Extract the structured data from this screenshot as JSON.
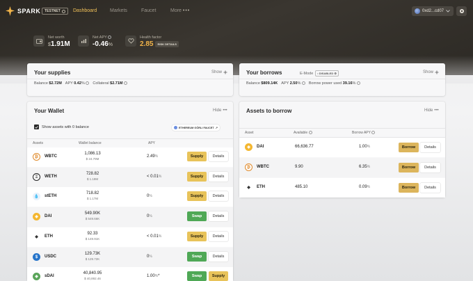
{
  "nav": {
    "brand": "SPARK",
    "testnet": "TESTNET",
    "links": [
      "Dashboard",
      "Markets",
      "Faucet",
      "More"
    ],
    "more_dots": "•••",
    "wallet": "0xd2...cd07"
  },
  "stats": {
    "net_worth": {
      "label": "Net worth",
      "currency": "$",
      "value": "1.91M"
    },
    "net_apy": {
      "label": "Net APY",
      "value": "-0.46",
      "unit": "%"
    },
    "health": {
      "label": "Health factor",
      "value": "2.85",
      "badge": "RISK DETAILS"
    }
  },
  "supplies": {
    "title": "Your supplies",
    "show": "Show",
    "balance_label": "Balance",
    "balance_currency": "$",
    "balance_value": "2.72M",
    "apy_label": "APY",
    "apy_value": "0.42",
    "apy_unit": "%",
    "collateral_label": "Collateral",
    "collateral_currency": "$",
    "collateral_value": "2.71M"
  },
  "borrows": {
    "title": "Your borrows",
    "emode_label": "E-Mode",
    "emode_badge": "DISABLED",
    "show": "Show",
    "balance_label": "Balance",
    "balance_currency": "$",
    "balance_value": "809.14K",
    "apy_label": "APY",
    "apy_value": "2.50",
    "apy_unit": "%",
    "power_label": "Borrow power used",
    "power_value": "39.16",
    "power_unit": "%"
  },
  "wallet": {
    "title": "Your Wallet",
    "hide": "Hide",
    "checkbox_label": "Show assets with 0 balance",
    "faucet": "ETHEREUM GÖRLI FAUCET",
    "headers": {
      "assets": "Assets",
      "balance": "Wallet balance",
      "apy": "APY"
    },
    "rows": [
      {
        "name": "WBTC",
        "amount": "1,086.13",
        "usd": "$ 24.79M",
        "apy": "2.49",
        "action": "Supply",
        "details": "Details"
      },
      {
        "name": "WETH",
        "amount": "728.82",
        "usd": "$ 1.18M",
        "apy": "< 0.01",
        "action": "Supply",
        "details": "Details"
      },
      {
        "name": "stETH",
        "amount": "718.82",
        "usd": "$ 1.17M",
        "apy": "0",
        "action": "Supply",
        "details": "Details"
      },
      {
        "name": "DAI",
        "amount": "549.90K",
        "usd": "$ 549.66K",
        "apy": "0",
        "action": "Swap",
        "details": "Details"
      },
      {
        "name": "ETH",
        "amount": "92.33",
        "usd": "$ 149.91K",
        "apy": "< 0.01",
        "action": "Supply",
        "details": "Details"
      },
      {
        "name": "USDC",
        "amount": "129.73K",
        "usd": "$ 129.72K",
        "apy": "0",
        "action": "Swap",
        "details": "Details"
      },
      {
        "name": "sDAI",
        "amount": "40,840.95",
        "usd": "$ 40,892.46",
        "apy": "1.00",
        "apy_suffix": "*",
        "action": "Swap",
        "action2": "Supply"
      }
    ]
  },
  "borrow_assets": {
    "title": "Assets to borrow",
    "hide": "Hide",
    "headers": {
      "asset": "Asset",
      "available": "Available",
      "apy": "Borrow APY"
    },
    "rows": [
      {
        "name": "DAI",
        "available": "66,636.77",
        "apy": "1.00",
        "action": "Borrow",
        "details": "Details"
      },
      {
        "name": "WBTC",
        "available": "9.90",
        "apy": "6.35",
        "action": "Borrow",
        "details": "Details"
      },
      {
        "name": "ETH",
        "available": "485.10",
        "apy": "0.09",
        "action": "Borrow",
        "details": "Details"
      }
    ]
  },
  "unit_pct": "%",
  "hide_dots": "•••",
  "colors": {
    "accent": "#f3c35a",
    "supply": "#e8c35a",
    "swap": "#4fa856",
    "hero": "#2a2722"
  }
}
